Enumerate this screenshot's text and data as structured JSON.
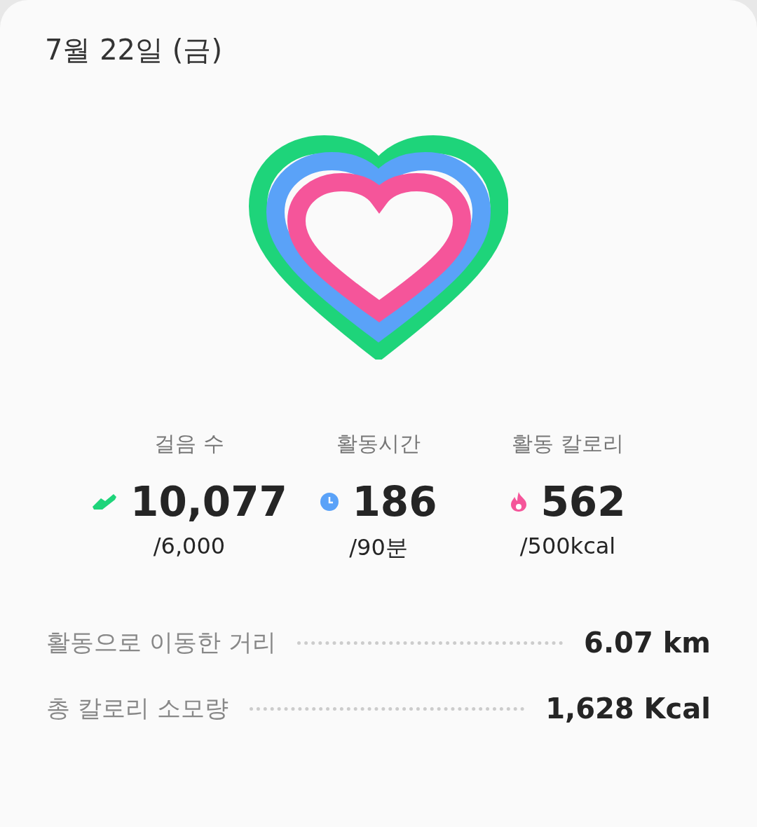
{
  "date": "7월 22일 (금)",
  "metrics": [
    {
      "kind": "steps",
      "label": "걸음 수",
      "value": "10,077",
      "goal": "/6,000",
      "color": "#1ed47a"
    },
    {
      "kind": "time",
      "label": "활동시간",
      "value": "186",
      "goal": "/90분",
      "color": "#5aa2f8"
    },
    {
      "kind": "calories",
      "label": "활동 칼로리",
      "value": "562",
      "goal": "/500kcal",
      "color": "#f5559a"
    }
  ],
  "summary": [
    {
      "label": "활동으로 이동한 거리",
      "value": "6.07 km"
    },
    {
      "label": "총 칼로리 소모량",
      "value": "1,628 Kcal"
    }
  ]
}
